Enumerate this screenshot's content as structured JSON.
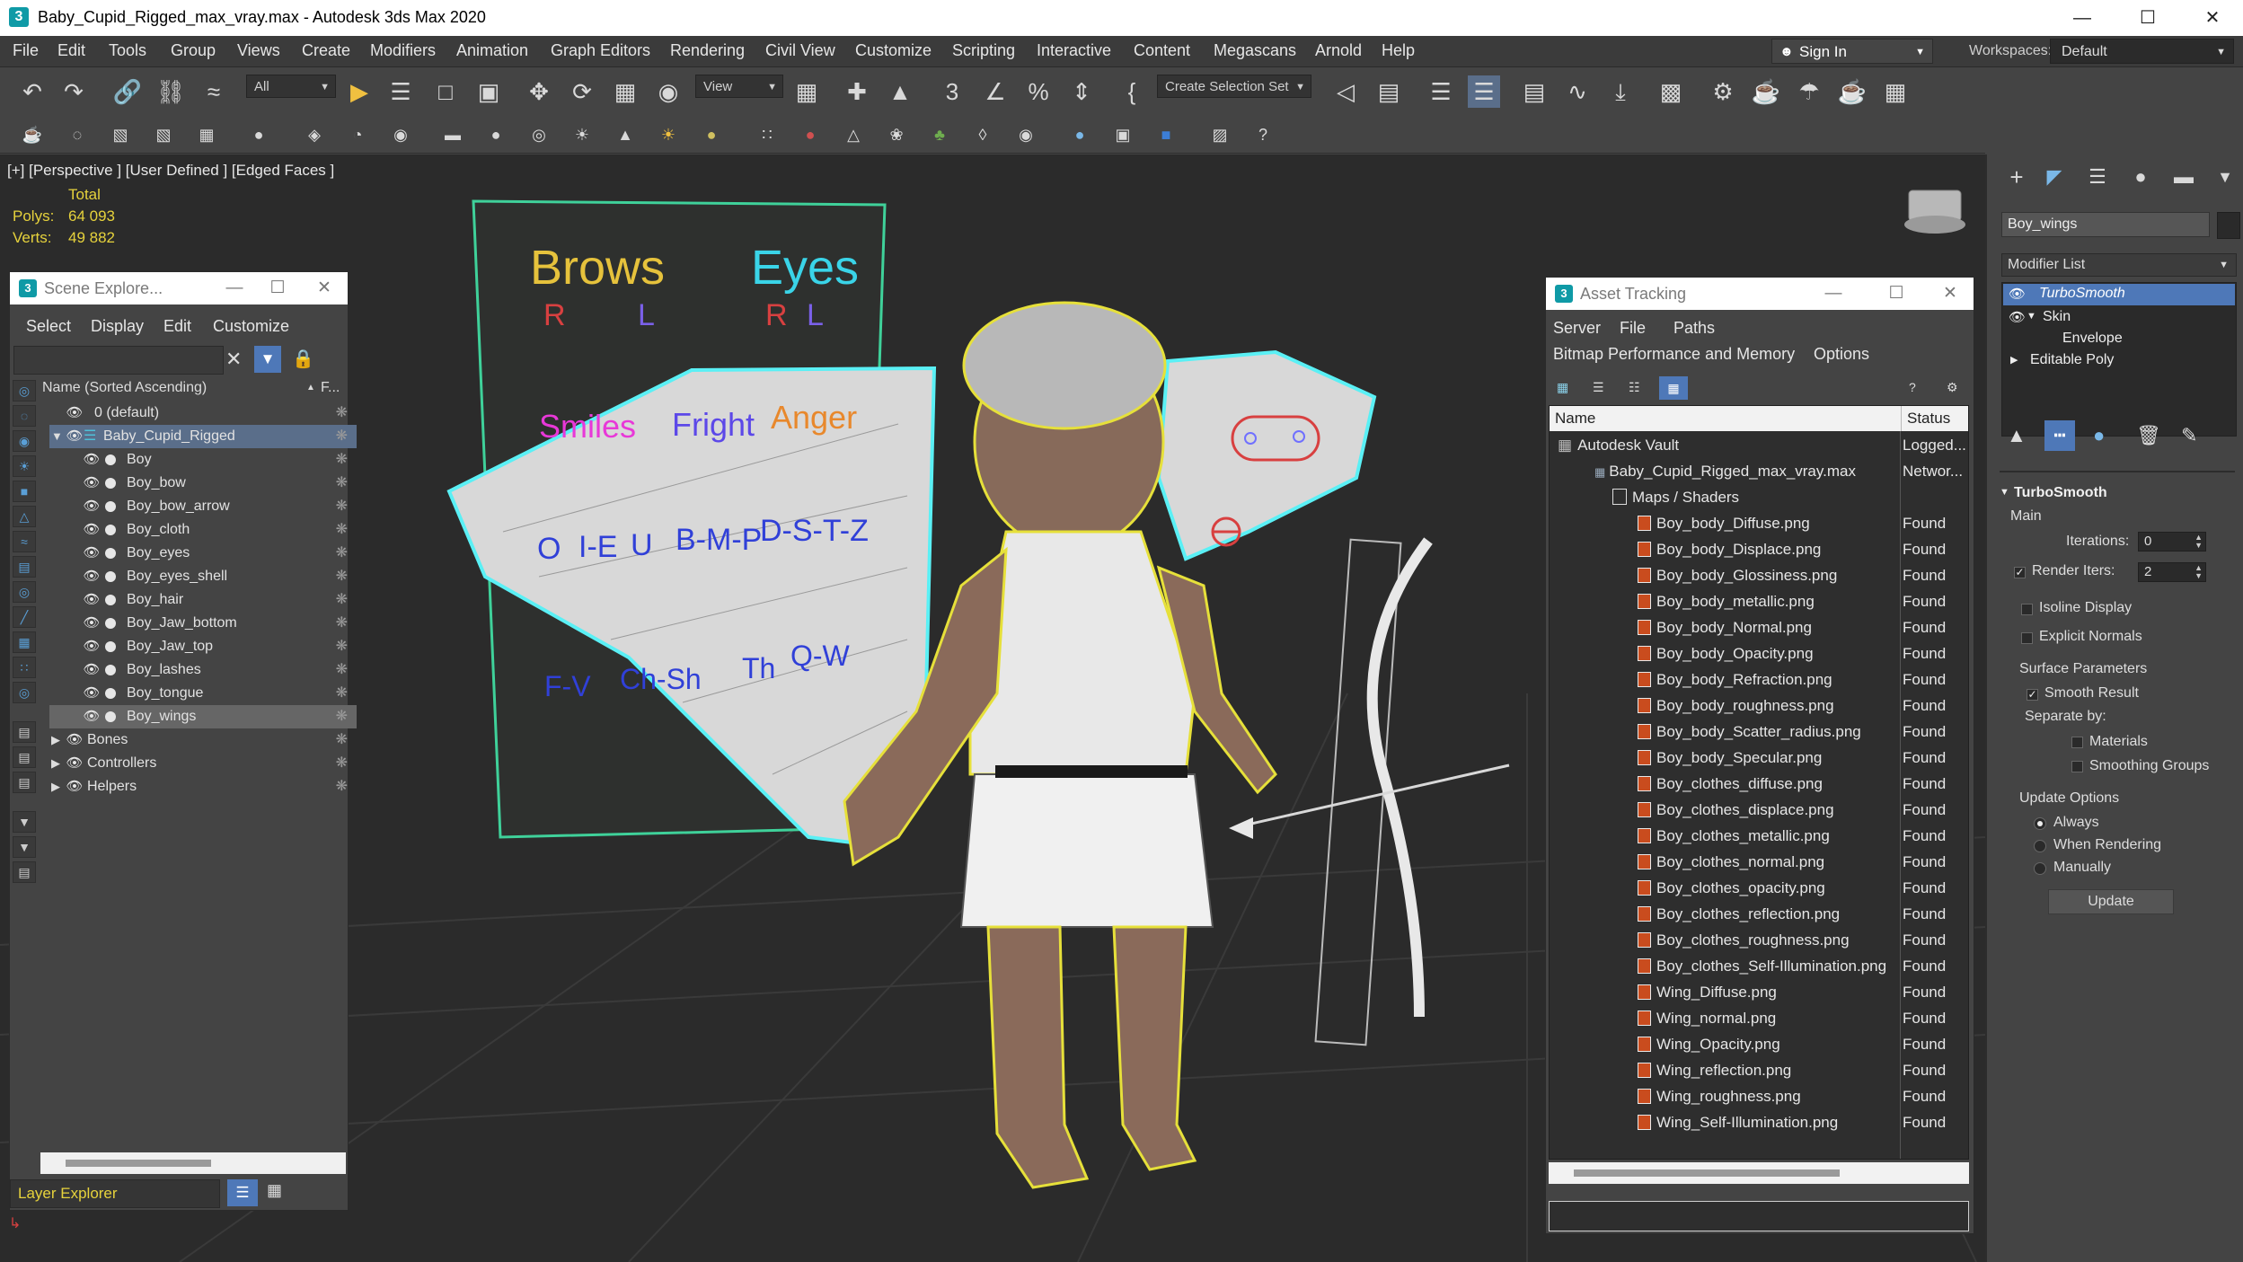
{
  "window": {
    "title": "Baby_Cupid_Rigged_max_vray.max - Autodesk 3ds Max 2020",
    "app_icon": "3",
    "controls": {
      "minimize": "—",
      "maximize": "☐",
      "close": "✕"
    }
  },
  "menubar": {
    "items": [
      "File",
      "Edit",
      "Tools",
      "Group",
      "Views",
      "Create",
      "Modifiers",
      "Animation",
      "Graph Editors",
      "Rendering",
      "Civil View",
      "Customize",
      "Scripting",
      "Interactive",
      "Content",
      "Megascans",
      "Arnold",
      "Help"
    ],
    "sign_in": "Sign In",
    "workspaces_label": "Workspaces:",
    "workspaces_value": "Default"
  },
  "toolbar": {
    "selection_filter": "All",
    "ref_coord": "View",
    "selection_set": "Create Selection Set"
  },
  "viewport": {
    "label": "[+] [Perspective ] [User Defined ] [Edged Faces ]",
    "stats_header": "Total",
    "polys_label": "Polys:",
    "polys_value": "64 093",
    "verts_label": "Verts:",
    "verts_value": "49 882",
    "face_labels": {
      "brows": "Brows",
      "eyes": "Eyes",
      "r": "R",
      "l": "L",
      "smiles": "Smiles",
      "fright": "Fright",
      "anger": "Anger",
      "o": "O",
      "ie": "I-E",
      "u": "U",
      "bmp": "B-M-P",
      "dstz": "D-S-T-Z",
      "fv": "F-V",
      "chsh": "Ch-Sh",
      "th": "Th",
      "qw": "Q-W"
    }
  },
  "scene_explorer": {
    "title": "Scene Explore...",
    "menus": [
      "Select",
      "Display",
      "Edit",
      "Customize"
    ],
    "col_name": "Name (Sorted Ascending)",
    "col_freeze": "F...",
    "rows": [
      {
        "label": "0 (default)"
      },
      {
        "label": "Baby_Cupid_Rigged"
      },
      {
        "label": "Boy"
      },
      {
        "label": "Boy_bow"
      },
      {
        "label": "Boy_bow_arrow"
      },
      {
        "label": "Boy_cloth"
      },
      {
        "label": "Boy_eyes"
      },
      {
        "label": "Boy_eyes_shell"
      },
      {
        "label": "Boy_hair"
      },
      {
        "label": "Boy_Jaw_bottom"
      },
      {
        "label": "Boy_Jaw_top"
      },
      {
        "label": "Boy_lashes"
      },
      {
        "label": "Boy_tongue"
      },
      {
        "label": "Boy_wings"
      },
      {
        "label": "Bones"
      },
      {
        "label": "Controllers"
      },
      {
        "label": "Helpers"
      }
    ],
    "footer_label": "Layer Explorer"
  },
  "asset_tracking": {
    "title": "Asset Tracking",
    "menus": [
      "Server",
      "File",
      "Paths",
      "Bitmap Performance and Memory",
      "Options"
    ],
    "col_name": "Name",
    "col_status": "Status",
    "rows": [
      {
        "name": "Autodesk Vault",
        "status": "Logged..."
      },
      {
        "name": "Baby_Cupid_Rigged_max_vray.max",
        "status": "Networ..."
      },
      {
        "name": "Maps / Shaders",
        "status": ""
      },
      {
        "name": "Boy_body_Diffuse.png",
        "status": "Found"
      },
      {
        "name": "Boy_body_Displace.png",
        "status": "Found"
      },
      {
        "name": "Boy_body_Glossiness.png",
        "status": "Found"
      },
      {
        "name": "Boy_body_metallic.png",
        "status": "Found"
      },
      {
        "name": "Boy_body_Normal.png",
        "status": "Found"
      },
      {
        "name": "Boy_body_Opacity.png",
        "status": "Found"
      },
      {
        "name": "Boy_body_Refraction.png",
        "status": "Found"
      },
      {
        "name": "Boy_body_roughness.png",
        "status": "Found"
      },
      {
        "name": "Boy_body_Scatter_radius.png",
        "status": "Found"
      },
      {
        "name": "Boy_body_Specular.png",
        "status": "Found"
      },
      {
        "name": "Boy_clothes_diffuse.png",
        "status": "Found"
      },
      {
        "name": "Boy_clothes_displace.png",
        "status": "Found"
      },
      {
        "name": "Boy_clothes_metallic.png",
        "status": "Found"
      },
      {
        "name": "Boy_clothes_normal.png",
        "status": "Found"
      },
      {
        "name": "Boy_clothes_opacity.png",
        "status": "Found"
      },
      {
        "name": "Boy_clothes_reflection.png",
        "status": "Found"
      },
      {
        "name": "Boy_clothes_roughness.png",
        "status": "Found"
      },
      {
        "name": "Boy_clothes_Self-Illumination.png",
        "status": "Found"
      },
      {
        "name": "Wing_Diffuse.png",
        "status": "Found"
      },
      {
        "name": "Wing_normal.png",
        "status": "Found"
      },
      {
        "name": "Wing_Opacity.png",
        "status": "Found"
      },
      {
        "name": "Wing_reflection.png",
        "status": "Found"
      },
      {
        "name": "Wing_roughness.png",
        "status": "Found"
      },
      {
        "name": "Wing_Self-Illumination.png",
        "status": "Found"
      }
    ]
  },
  "command_panel": {
    "object_name": "Boy_wings",
    "modifier_list_label": "Modifier List",
    "stack": [
      "TurboSmooth",
      "Skin",
      "Envelope",
      "Editable Poly"
    ],
    "rollout_title": "TurboSmooth",
    "main_label": "Main",
    "iterations_label": "Iterations:",
    "iterations_value": "0",
    "render_iters_label": "Render Iters:",
    "render_iters_value": "2",
    "isoline_label": "Isoline Display",
    "explicit_normals_label": "Explicit Normals",
    "surface_params_label": "Surface Parameters",
    "smooth_result_label": "Smooth Result",
    "separate_by_label": "Separate by:",
    "materials_label": "Materials",
    "smoothing_groups_label": "Smoothing Groups",
    "update_options_label": "Update Options",
    "always_label": "Always",
    "when_rendering_label": "When Rendering",
    "manually_label": "Manually",
    "update_button": "Update"
  },
  "colors": {
    "ui_bg": "#444444",
    "viewport_bg": "#2b2b2b",
    "selection_blue": "#5a6e8a",
    "stats_yellow": "#e6d23c",
    "turbosmooth_highlight": "#4e78b8"
  }
}
